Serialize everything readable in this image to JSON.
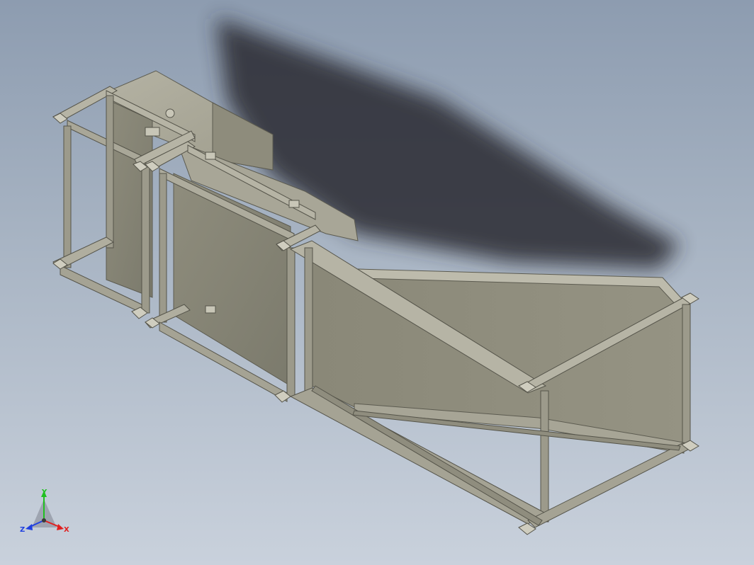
{
  "viewport": {
    "background_top": "#8d9cb0",
    "background_bottom": "#c9d1dc",
    "model_color": "#8d8b7b",
    "shadow_color": "#2a2c32"
  },
  "view_triad": {
    "x_label": "X",
    "y_label": "Y",
    "z_label": "Z",
    "x_color": "#e02020",
    "y_color": "#20c020",
    "z_color": "#2040e0"
  }
}
